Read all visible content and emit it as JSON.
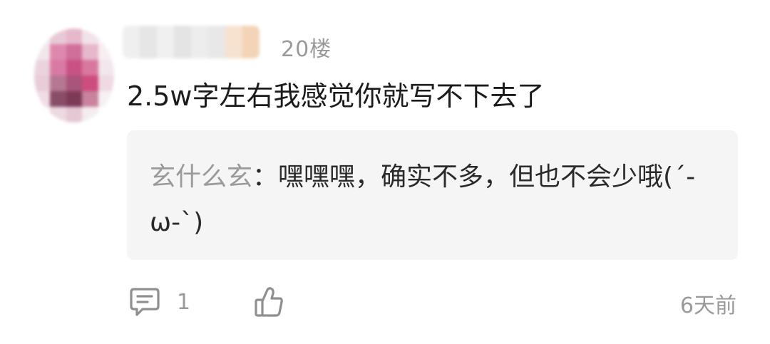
{
  "comment": {
    "floor": "20楼",
    "text": "2.5w字左右我感觉你就写不下去了",
    "reply": {
      "author": "玄什么玄",
      "separator": "：",
      "text": "嘿嘿嘿，确实不多，但也不会少哦(´-ω-`)"
    },
    "reply_count": "1",
    "time": "6天前"
  },
  "icons": {
    "comment": "comment-bubble-icon",
    "like": "thumbs-up-icon"
  },
  "colors": {
    "text": "#1b1b1b",
    "muted": "#9a9a9a",
    "reply_bg": "#f5f5f5"
  }
}
